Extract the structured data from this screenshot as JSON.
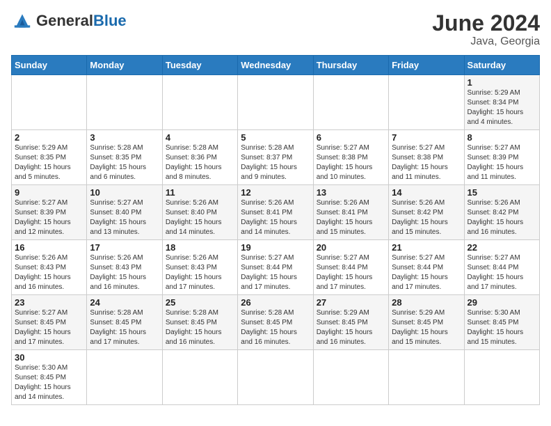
{
  "header": {
    "logo_general": "General",
    "logo_blue": "Blue",
    "month_title": "June 2024",
    "location": "Java, Georgia"
  },
  "days_of_week": [
    "Sunday",
    "Monday",
    "Tuesday",
    "Wednesday",
    "Thursday",
    "Friday",
    "Saturday"
  ],
  "weeks": [
    {
      "days": [
        {
          "date": "",
          "info": ""
        },
        {
          "date": "",
          "info": ""
        },
        {
          "date": "",
          "info": ""
        },
        {
          "date": "",
          "info": ""
        },
        {
          "date": "",
          "info": ""
        },
        {
          "date": "",
          "info": ""
        },
        {
          "date": "1",
          "info": "Sunrise: 5:29 AM\nSunset: 8:34 PM\nDaylight: 15 hours\nand 4 minutes."
        }
      ]
    },
    {
      "days": [
        {
          "date": "2",
          "info": "Sunrise: 5:29 AM\nSunset: 8:35 PM\nDaylight: 15 hours\nand 5 minutes."
        },
        {
          "date": "3",
          "info": "Sunrise: 5:28 AM\nSunset: 8:35 PM\nDaylight: 15 hours\nand 6 minutes."
        },
        {
          "date": "4",
          "info": "Sunrise: 5:28 AM\nSunset: 8:36 PM\nDaylight: 15 hours\nand 8 minutes."
        },
        {
          "date": "5",
          "info": "Sunrise: 5:28 AM\nSunset: 8:37 PM\nDaylight: 15 hours\nand 9 minutes."
        },
        {
          "date": "6",
          "info": "Sunrise: 5:27 AM\nSunset: 8:38 PM\nDaylight: 15 hours\nand 10 minutes."
        },
        {
          "date": "7",
          "info": "Sunrise: 5:27 AM\nSunset: 8:38 PM\nDaylight: 15 hours\nand 11 minutes."
        },
        {
          "date": "8",
          "info": "Sunrise: 5:27 AM\nSunset: 8:39 PM\nDaylight: 15 hours\nand 11 minutes."
        }
      ]
    },
    {
      "days": [
        {
          "date": "9",
          "info": "Sunrise: 5:27 AM\nSunset: 8:39 PM\nDaylight: 15 hours\nand 12 minutes."
        },
        {
          "date": "10",
          "info": "Sunrise: 5:27 AM\nSunset: 8:40 PM\nDaylight: 15 hours\nand 13 minutes."
        },
        {
          "date": "11",
          "info": "Sunrise: 5:26 AM\nSunset: 8:40 PM\nDaylight: 15 hours\nand 14 minutes."
        },
        {
          "date": "12",
          "info": "Sunrise: 5:26 AM\nSunset: 8:41 PM\nDaylight: 15 hours\nand 14 minutes."
        },
        {
          "date": "13",
          "info": "Sunrise: 5:26 AM\nSunset: 8:41 PM\nDaylight: 15 hours\nand 15 minutes."
        },
        {
          "date": "14",
          "info": "Sunrise: 5:26 AM\nSunset: 8:42 PM\nDaylight: 15 hours\nand 15 minutes."
        },
        {
          "date": "15",
          "info": "Sunrise: 5:26 AM\nSunset: 8:42 PM\nDaylight: 15 hours\nand 16 minutes."
        }
      ]
    },
    {
      "days": [
        {
          "date": "16",
          "info": "Sunrise: 5:26 AM\nSunset: 8:43 PM\nDaylight: 15 hours\nand 16 minutes."
        },
        {
          "date": "17",
          "info": "Sunrise: 5:26 AM\nSunset: 8:43 PM\nDaylight: 15 hours\nand 16 minutes."
        },
        {
          "date": "18",
          "info": "Sunrise: 5:26 AM\nSunset: 8:43 PM\nDaylight: 15 hours\nand 17 minutes."
        },
        {
          "date": "19",
          "info": "Sunrise: 5:27 AM\nSunset: 8:44 PM\nDaylight: 15 hours\nand 17 minutes."
        },
        {
          "date": "20",
          "info": "Sunrise: 5:27 AM\nSunset: 8:44 PM\nDaylight: 15 hours\nand 17 minutes."
        },
        {
          "date": "21",
          "info": "Sunrise: 5:27 AM\nSunset: 8:44 PM\nDaylight: 15 hours\nand 17 minutes."
        },
        {
          "date": "22",
          "info": "Sunrise: 5:27 AM\nSunset: 8:44 PM\nDaylight: 15 hours\nand 17 minutes."
        }
      ]
    },
    {
      "days": [
        {
          "date": "23",
          "info": "Sunrise: 5:27 AM\nSunset: 8:45 PM\nDaylight: 15 hours\nand 17 minutes."
        },
        {
          "date": "24",
          "info": "Sunrise: 5:28 AM\nSunset: 8:45 PM\nDaylight: 15 hours\nand 17 minutes."
        },
        {
          "date": "25",
          "info": "Sunrise: 5:28 AM\nSunset: 8:45 PM\nDaylight: 15 hours\nand 16 minutes."
        },
        {
          "date": "26",
          "info": "Sunrise: 5:28 AM\nSunset: 8:45 PM\nDaylight: 15 hours\nand 16 minutes."
        },
        {
          "date": "27",
          "info": "Sunrise: 5:29 AM\nSunset: 8:45 PM\nDaylight: 15 hours\nand 16 minutes."
        },
        {
          "date": "28",
          "info": "Sunrise: 5:29 AM\nSunset: 8:45 PM\nDaylight: 15 hours\nand 15 minutes."
        },
        {
          "date": "29",
          "info": "Sunrise: 5:30 AM\nSunset: 8:45 PM\nDaylight: 15 hours\nand 15 minutes."
        }
      ]
    },
    {
      "days": [
        {
          "date": "30",
          "info": "Sunrise: 5:30 AM\nSunset: 8:45 PM\nDaylight: 15 hours\nand 14 minutes."
        },
        {
          "date": "",
          "info": ""
        },
        {
          "date": "",
          "info": ""
        },
        {
          "date": "",
          "info": ""
        },
        {
          "date": "",
          "info": ""
        },
        {
          "date": "",
          "info": ""
        },
        {
          "date": "",
          "info": ""
        }
      ]
    }
  ]
}
